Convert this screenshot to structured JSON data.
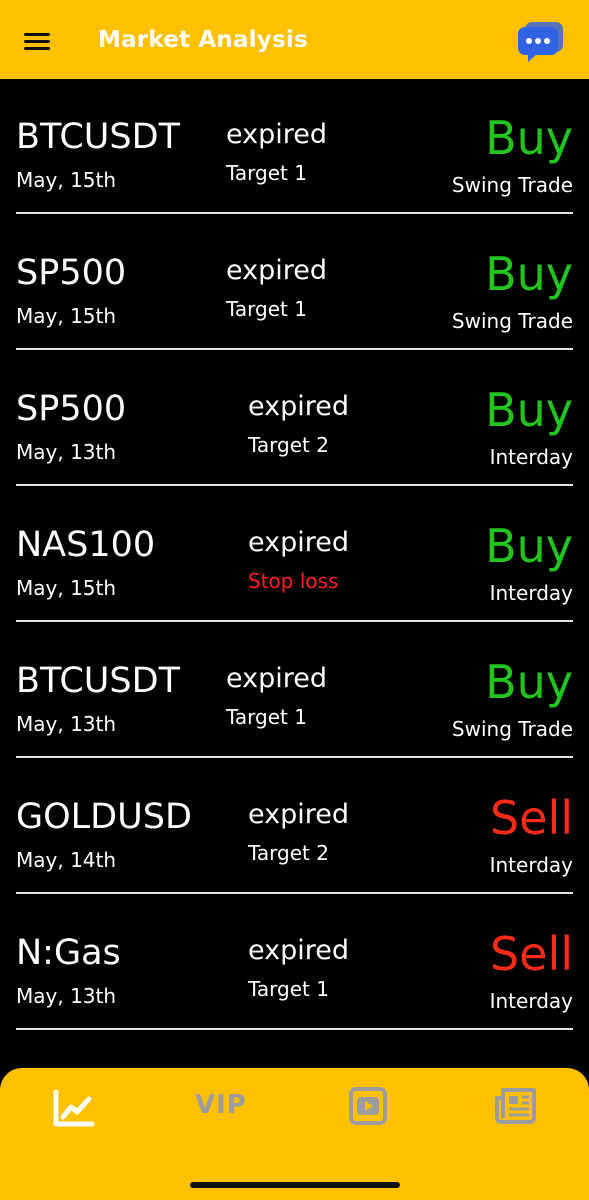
{
  "header": {
    "title": "Market Analysis",
    "menu_icon": "hamburger-menu-icon",
    "chat_icon": "chat-bubble-icon"
  },
  "colors": {
    "accent": "#FFC000",
    "buy": "#22C41E",
    "sell": "#FF2B1A",
    "stop_loss": "#FF1F1F",
    "background": "#000000"
  },
  "signals": [
    {
      "symbol": "BTCUSDT",
      "date": "May, 15th",
      "status": "expired",
      "result": "Target 1",
      "signal": "Buy",
      "trade_type": "Swing Trade"
    },
    {
      "symbol": "SP500",
      "date": "May, 15th",
      "status": "expired",
      "result": "Target 1",
      "signal": "Buy",
      "trade_type": "Swing Trade"
    },
    {
      "symbol": "SP500",
      "date": "May, 13th",
      "status": "expired",
      "result": "Target 2",
      "signal": "Buy",
      "trade_type": "Interday"
    },
    {
      "symbol": "NAS100",
      "date": "May, 15th",
      "status": "expired",
      "result": "Stop loss",
      "signal": "Buy",
      "trade_type": "Interday"
    },
    {
      "symbol": "BTCUSDT",
      "date": "May, 13th",
      "status": "expired",
      "result": "Target 1",
      "signal": "Buy",
      "trade_type": "Swing Trade"
    },
    {
      "symbol": "GOLDUSD",
      "date": "May, 14th",
      "status": "expired",
      "result": "Target 2",
      "signal": "Sell",
      "trade_type": "Interday"
    },
    {
      "symbol": "N:Gas",
      "date": "May, 13th",
      "status": "expired",
      "result": "Target 1",
      "signal": "Sell",
      "trade_type": "Interday"
    }
  ],
  "bottom_nav": {
    "items": [
      {
        "icon": "chart-line-icon",
        "active": true
      },
      {
        "label": "VIP",
        "active": false
      },
      {
        "icon": "youtube-play-icon",
        "active": false
      },
      {
        "icon": "newspaper-icon",
        "active": false
      }
    ]
  }
}
